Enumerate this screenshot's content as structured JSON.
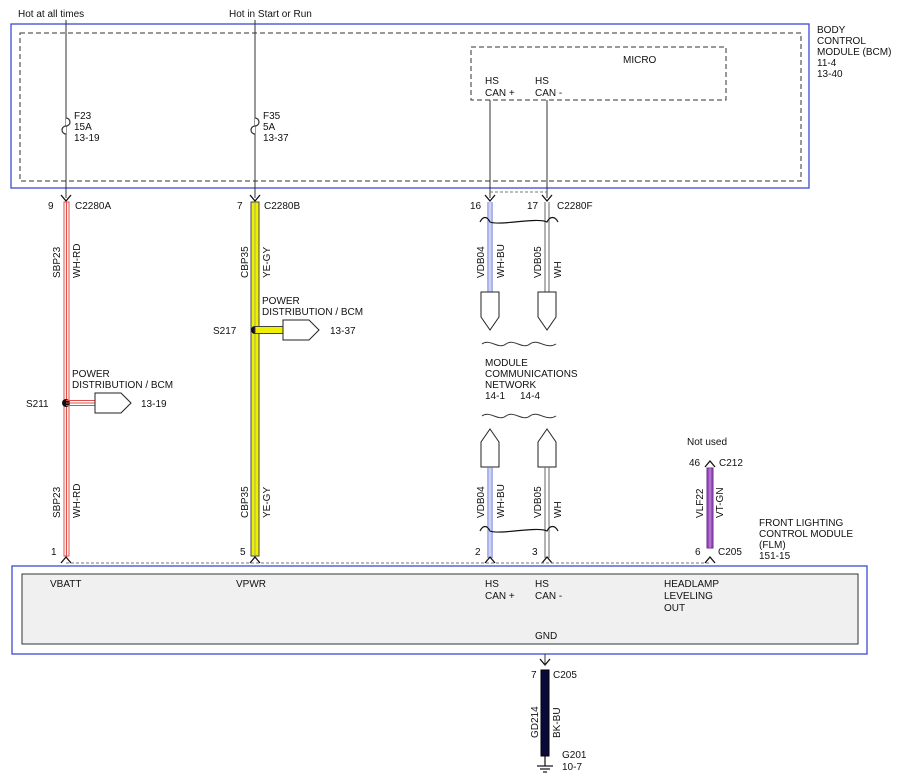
{
  "top_labels": {
    "hot_at_all_times": "Hot at all times",
    "hot_in_start_run": "Hot in Start or Run"
  },
  "bcm": {
    "title_lines": [
      "BODY",
      "CONTROL",
      "MODULE (BCM)",
      "11-4",
      "13-40"
    ],
    "micro_label": "MICRO",
    "hs_can_plus": [
      "HS",
      "CAN +"
    ],
    "hs_can_minus": [
      "HS",
      "CAN -"
    ]
  },
  "fuses": {
    "f23": [
      "F23",
      "15A",
      "13-19"
    ],
    "f35": [
      "F35",
      "5A",
      "13-37"
    ]
  },
  "connectors": {
    "c2280a": "C2280A",
    "pin_9": "9",
    "c2280b": "C2280B",
    "pin_7": "7",
    "c2280f": "C2280F",
    "pin_16": "16",
    "pin_17": "17",
    "c212": "C212",
    "pin_46": "46",
    "not_used": "Not used",
    "c205_flm": "C205",
    "pin_1": "1",
    "pin_5": "5",
    "pin_2": "2",
    "pin_3": "3",
    "pin_6": "6",
    "c205_gnd": "C205",
    "pin_7_gnd": "7"
  },
  "wires": {
    "sbp23": "SBP23",
    "wh_rd": "WH-RD",
    "cbp35": "CBP35",
    "ye_gy": "YE-GY",
    "vdb04": "VDB04",
    "wh_bu": "WH-BU",
    "vdb05": "VDB05",
    "wh": "WH",
    "vlf22": "VLF22",
    "vt_gn": "VT-GN",
    "gd214": "GD214",
    "bk_bu": "BK-BU"
  },
  "splices": {
    "s211": "S211",
    "s211_dest": [
      "POWER",
      "DISTRIBUTION / BCM"
    ],
    "s211_ref": "13-19",
    "s217": "S217",
    "s217_dest": [
      "POWER",
      "DISTRIBUTION / BCM"
    ],
    "s217_ref": "13-37"
  },
  "network": {
    "lines": [
      "MODULE",
      "COMMUNICATIONS",
      "NETWORK"
    ],
    "ref_1": "14-1",
    "ref_2": "14-4"
  },
  "flm": {
    "title_lines": [
      "FRONT LIGHTING",
      "CONTROL MODULE",
      "(FLM)",
      "151-15"
    ],
    "vbatt": "VBATT",
    "vpwr": "VPWR",
    "hs_can_plus": [
      "HS",
      "CAN +"
    ],
    "hs_can_minus": [
      "HS",
      "CAN -"
    ],
    "headlamp": [
      "HEADLAMP",
      "LEVELING",
      "OUT"
    ],
    "gnd": "GND"
  },
  "ground": {
    "g201": "G201",
    "ref": "10-7"
  },
  "colors": {
    "module_border": "#3b4ccf",
    "module_fill": "#f0f0f0",
    "wire_red": "#e0504a",
    "wire_yellow": "#eef000",
    "wire_blue": "#5a6bd8",
    "wire_violet": "#9b4fc0",
    "wire_black": "#0a0a3a"
  }
}
